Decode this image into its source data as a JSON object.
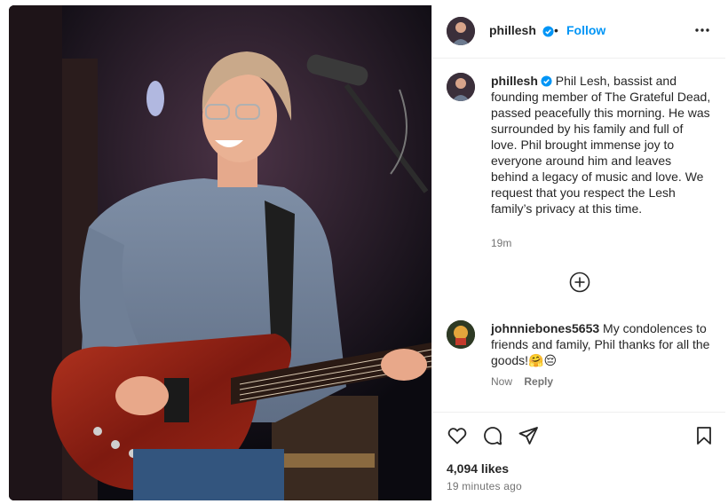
{
  "post": {
    "username": "phillesh",
    "follow_label": "Follow",
    "separator": "•",
    "caption": "Phil Lesh, bassist and founding member of The Grateful Dead, passed peacefully this morning. He was surrounded by his family and full of love. Phil brought immense joy to everyone around him and leaves behind a legacy of music and love. We request that you respect the Lesh family’s privacy at this time.",
    "caption_time": "19m",
    "likes": "4,094 likes",
    "posted_ago": "19 minutes ago"
  },
  "comment": {
    "username": "johnniebones5653",
    "text": "My condolences to friends and family, Phil thanks for all the goods!🤗😔",
    "time": "Now",
    "reply_label": "Reply"
  },
  "icons": {
    "verified": "verified-badge-icon",
    "more": "more-options-icon",
    "load_more": "plus-circle-icon",
    "like": "heart-icon",
    "comment": "comment-bubble-icon",
    "share": "paper-plane-icon",
    "save": "bookmark-icon"
  },
  "colors": {
    "accent": "#0095f6",
    "text": "#262626",
    "muted": "#737373",
    "divider": "#efefef"
  }
}
